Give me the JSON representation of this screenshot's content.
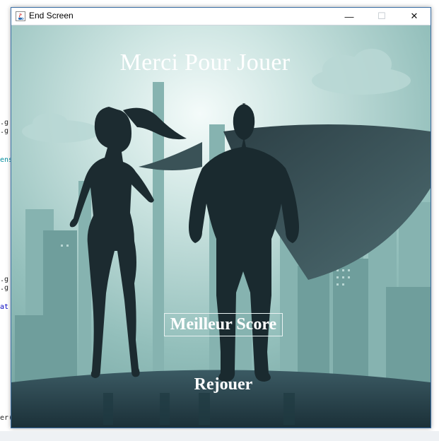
{
  "window": {
    "title": "End Screen",
    "controls": {
      "minimize": "—",
      "maximize": "☐",
      "close": "✕"
    }
  },
  "screen": {
    "headline": "Merci Pour Jouer",
    "best_score_label": "Meilleur Score",
    "replay_label": "Rejouer"
  },
  "background_code_fragments": [
    ".g",
    ".g",
    "ens",
    ".g",
    ".g",
    "at",
    "er("
  ],
  "colors": {
    "title_bar": "#ffffff",
    "window_border": "#3b6fa6",
    "sky_light": "#cfe6e3",
    "sky_mid": "#8fbdb9",
    "silhouette": "#1c2b30",
    "text": "#ffffff"
  },
  "icons": {
    "app": "java-coffee-icon"
  }
}
